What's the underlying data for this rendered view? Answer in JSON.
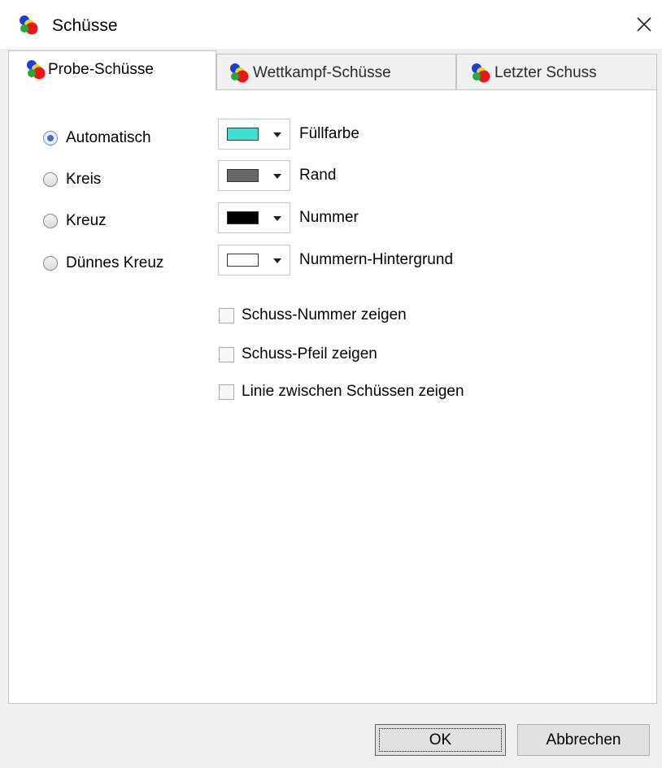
{
  "window": {
    "title": "Schüsse",
    "icon": "shots-icon",
    "close_icon": "close-icon"
  },
  "tabs": [
    {
      "label": "Probe-Schüsse",
      "icon": "shots-icon",
      "active": true
    },
    {
      "label": "Wettkampf-Schüsse",
      "icon": "shots-icon",
      "active": false
    },
    {
      "label": "Letzter Schuss",
      "icon": "shots-icon",
      "active": false
    }
  ],
  "shape_options": [
    {
      "label": "Automatisch",
      "checked": true
    },
    {
      "label": "Kreis",
      "checked": false
    },
    {
      "label": "Kreuz",
      "checked": false
    },
    {
      "label": "Dünnes Kreuz",
      "checked": false
    }
  ],
  "color_options": [
    {
      "label": "Füllfarbe",
      "color": "#40e0d0"
    },
    {
      "label": "Rand",
      "color": "#696969"
    },
    {
      "label": "Nummer",
      "color": "#000000"
    },
    {
      "label": "Nummern-Hintergrund",
      "color": "#ffffff"
    }
  ],
  "checkboxes": [
    {
      "label": "Schuss-Nummer zeigen",
      "checked": false
    },
    {
      "label": "Schuss-Pfeil zeigen",
      "checked": false
    },
    {
      "label": "Linie zwischen Schüssen zeigen",
      "checked": false
    }
  ],
  "buttons": {
    "ok": "OK",
    "cancel": "Abbrechen"
  }
}
